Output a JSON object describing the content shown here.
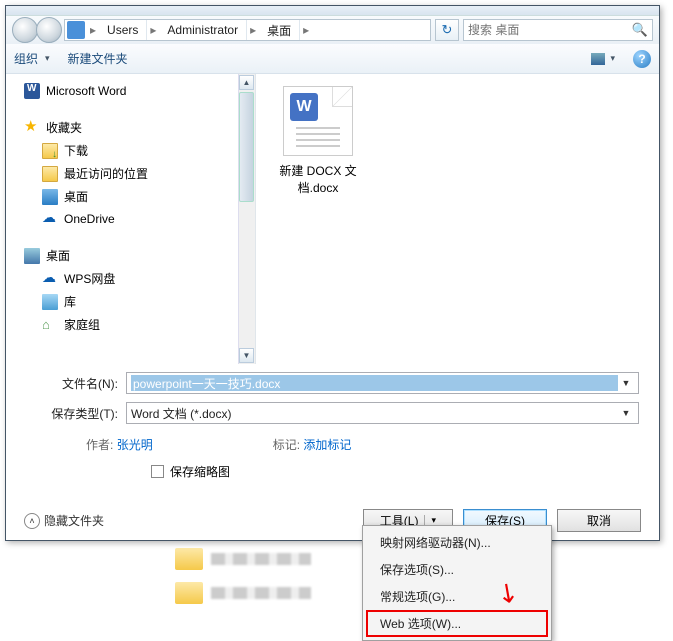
{
  "breadcrumb": {
    "seg1": "Users",
    "seg2": "Administrator",
    "seg3": "桌面"
  },
  "search": {
    "placeholder": "搜索 桌面"
  },
  "toolbar": {
    "organize": "组织",
    "new_folder": "新建文件夹"
  },
  "sidebar": {
    "word": "Microsoft Word",
    "favorites": "收藏夹",
    "downloads": "下载",
    "recent": "最近访问的位置",
    "desktop": "桌面",
    "onedrive": "OneDrive",
    "desktop2": "桌面",
    "wps": "WPS网盘",
    "library": "库",
    "homegroup": "家庭组"
  },
  "file": {
    "name": "新建 DOCX 文档.docx",
    "badge": "W"
  },
  "form": {
    "filename_label": "文件名(N):",
    "filename_value": "powerpoint一天一技巧.docx",
    "filetype_label": "保存类型(T):",
    "filetype_value": "Word 文档 (*.docx)",
    "author_label": "作者:",
    "author_value": "张光明",
    "tags_label": "标记:",
    "tags_value": "添加标记",
    "thumb_label": "保存缩略图"
  },
  "buttons": {
    "hide_folders": "隐藏文件夹",
    "tools": "工具(L)",
    "save": "保存(S)",
    "cancel": "取消"
  },
  "menu": {
    "item1": "映射网络驱动器(N)...",
    "item2": "保存选项(S)...",
    "item3": "常规选项(G)...",
    "item4": "Web 选项(W)..."
  }
}
